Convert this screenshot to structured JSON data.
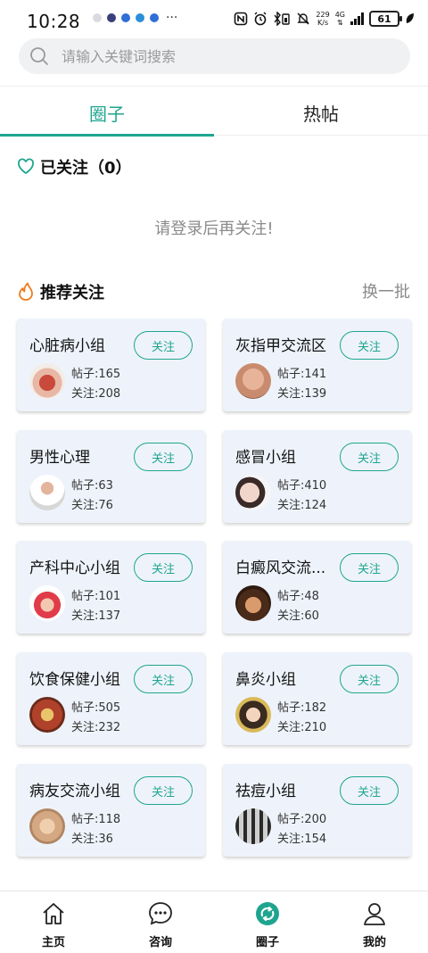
{
  "status_bar": {
    "time": "10:28",
    "net_speed_value": "229",
    "net_speed_unit": "K/s",
    "net_type": "4G",
    "battery": "61"
  },
  "search": {
    "placeholder": "请输入关键词搜索"
  },
  "tabs": [
    {
      "label": "圈子",
      "active": true
    },
    {
      "label": "热帖",
      "active": false
    }
  ],
  "followed": {
    "title": "已关注（0）",
    "login_hint": "请登录后再关注!"
  },
  "recommend": {
    "title": "推荐关注",
    "refresh": "换一批"
  },
  "groups": [
    {
      "name": "心脏病小组",
      "posts": "帖子:165",
      "follows": "关注:208",
      "button": "关注",
      "avatar_icon": "heart-anatomy-avatar"
    },
    {
      "name": "灰指甲交流区",
      "posts": "帖子:141",
      "follows": "关注:139",
      "button": "关注",
      "avatar_icon": "foot-avatar"
    },
    {
      "name": "男性心理",
      "posts": "帖子:63",
      "follows": "关注:76",
      "button": "关注",
      "avatar_icon": "man-avatar"
    },
    {
      "name": "感冒小组",
      "posts": "帖子:410",
      "follows": "关注:124",
      "button": "关注",
      "avatar_icon": "sneezing-woman-avatar"
    },
    {
      "name": "产科中心小组",
      "posts": "帖子:101",
      "follows": "关注:137",
      "button": "关注",
      "avatar_icon": "baby-avatar"
    },
    {
      "name": "白癜风交流...",
      "posts": "帖子:48",
      "follows": "关注:60",
      "button": "关注",
      "avatar_icon": "cartoon-child-avatar"
    },
    {
      "name": "饮食保健小组",
      "posts": "帖子:505",
      "follows": "关注:232",
      "button": "关注",
      "avatar_icon": "food-avatar"
    },
    {
      "name": "鼻炎小组",
      "posts": "帖子:182",
      "follows": "关注:210",
      "button": "关注",
      "avatar_icon": "tissue-person-avatar"
    },
    {
      "name": "病友交流小组",
      "posts": "帖子:118",
      "follows": "关注:36",
      "button": "关注",
      "avatar_icon": "people-avatar"
    },
    {
      "name": "祛痘小组",
      "posts": "帖子:200",
      "follows": "关注:154",
      "button": "关注",
      "avatar_icon": "face-avatar"
    }
  ],
  "nav": [
    {
      "label": "主页",
      "icon": "home-icon"
    },
    {
      "label": "咨询",
      "icon": "chat-icon"
    },
    {
      "label": "圈子",
      "icon": "circle-logo-icon"
    },
    {
      "label": "我的",
      "icon": "user-icon"
    }
  ],
  "colors": {
    "accent": "#1fa58f",
    "card_bg": "#eef3fb",
    "hint": "#8a8a8a",
    "flame": "#f07a1a"
  }
}
